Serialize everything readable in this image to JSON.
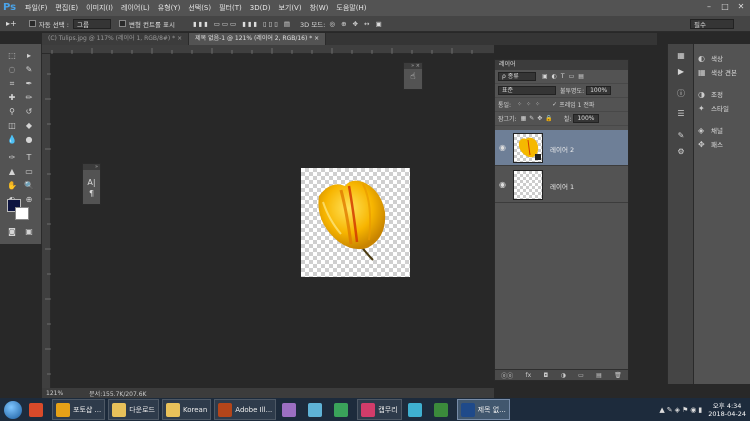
{
  "app": {
    "logo": "Ps"
  },
  "menu": [
    "파일(F)",
    "편집(E)",
    "이미지(I)",
    "레이어(L)",
    "유형(Y)",
    "선택(S)",
    "필터(T)",
    "3D(D)",
    "보기(V)",
    "창(W)",
    "도움말(H)"
  ],
  "window_controls": [
    "–",
    "□",
    "✕"
  ],
  "options": {
    "auto_select_label": "자동 선택 :",
    "auto_select_value": "그룹",
    "show_transform_label": "변형 컨트롤 표시",
    "mode_3d_label": "3D 모드:",
    "workspace": "필수"
  },
  "tabs": [
    {
      "label": "(C) Tulips.jpg @ 117% (레이어 1, RGB/8#) *",
      "close": "×"
    },
    {
      "label": "제목 없음-1 @ 121% (레이어 2, RGB/16) *",
      "close": "×"
    }
  ],
  "char_panel": {
    "icon_top": "A|",
    "icon_bottom": "¶"
  },
  "layers_panel": {
    "title": "레이어",
    "kind_filter": "ρ 종류",
    "blend_mode": "표준",
    "opacity_label": "불투명도:",
    "opacity_value": "100%",
    "lock_label": "잠그기:",
    "fill_label": "칠:",
    "fill_value": "100%",
    "frame_label": "프레임 1 전파",
    "unify_label": "통일:",
    "layers": [
      {
        "name": "레이어 2",
        "selected": true
      },
      {
        "name": "레이어 1",
        "selected": false
      }
    ],
    "footer_icons": [
      "ⓞⓞ",
      "fx",
      "◘",
      "◑",
      "▭",
      "▤",
      "🗑"
    ]
  },
  "right_panels": {
    "groups": [
      [
        "색상",
        "색상 견본"
      ],
      [
        "조정",
        "스타일"
      ],
      [
        "채널",
        "패스"
      ]
    ]
  },
  "status": {
    "zoom": "121%",
    "doc": "문서:155.7K/207.6K"
  },
  "taskbar": {
    "items": [
      {
        "label": "",
        "color": "#d84a2a"
      },
      {
        "label": "포토샵 ...",
        "color": "#e6a117",
        "wide": true
      },
      {
        "label": "다운로드",
        "color": "#e8c15a",
        "wide": true
      },
      {
        "label": "Korean",
        "color": "#e8c15a",
        "wide": true
      },
      {
        "label": "Adobe Ill...",
        "color": "#b3451a",
        "wide": true
      },
      {
        "label": "",
        "color": "#9c6fc2"
      },
      {
        "label": "",
        "color": "#5fb3d6"
      },
      {
        "label": "",
        "color": "#3aa35a"
      },
      {
        "label": "캡무리",
        "color": "#d23c6a",
        "wide": true
      },
      {
        "label": "",
        "color": "#3fb0d0"
      },
      {
        "label": "",
        "color": "#3b8a3b"
      },
      {
        "label": "제목 없...",
        "color": "#1f4a8a",
        "active": true
      }
    ],
    "time": "오후 4:34",
    "date": "2018-04-24"
  }
}
